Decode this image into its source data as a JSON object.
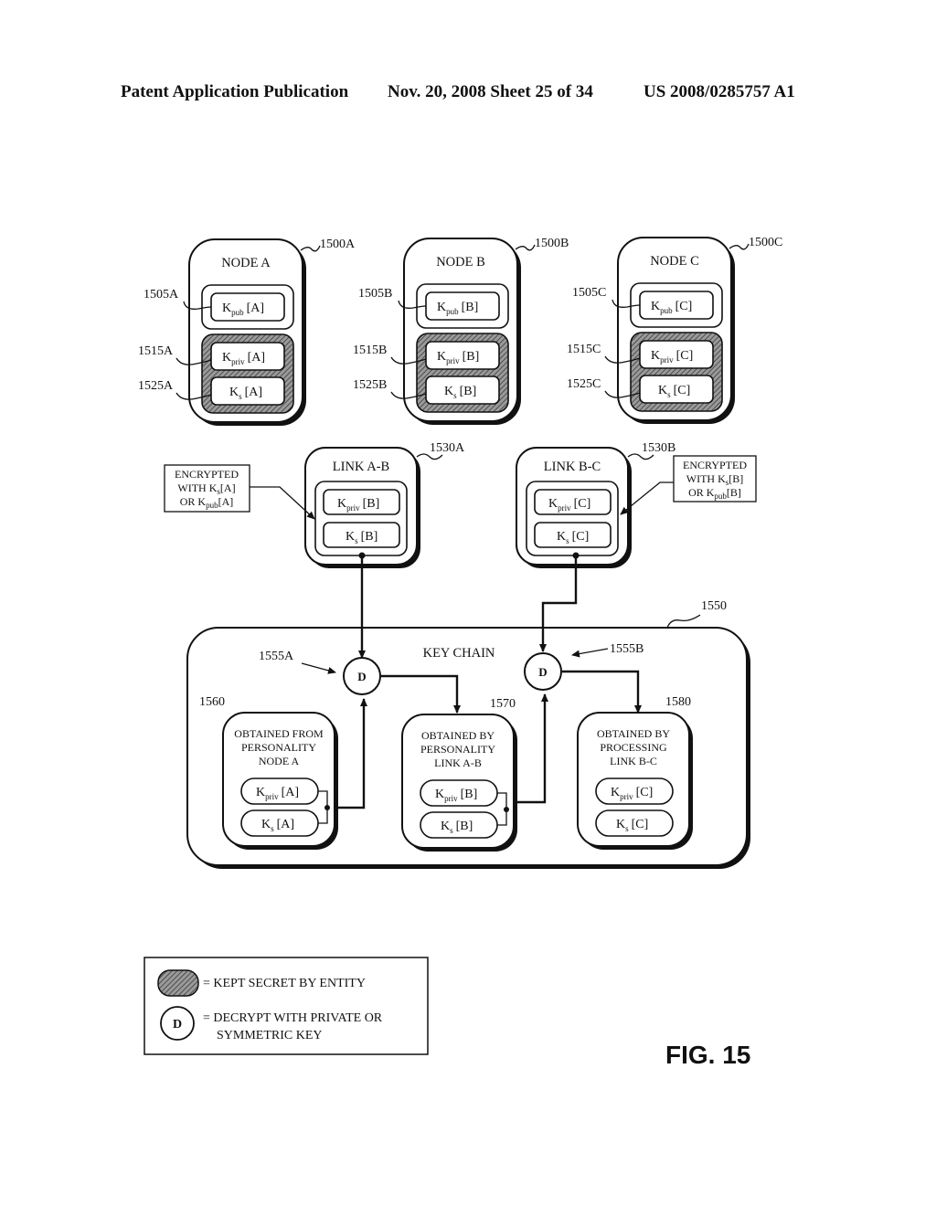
{
  "header": {
    "left": "Patent Application Publication",
    "date_sheet": "Nov. 20, 2008  Sheet 25 of 34",
    "number": "US 2008/0285757 A1"
  },
  "nodes": [
    {
      "ref": "1500A",
      "title": "NODE A",
      "pub_ref": "1505A",
      "priv_ref": "1515A",
      "ks_ref": "1525A",
      "id": "A"
    },
    {
      "ref": "1500B",
      "title": "NODE B",
      "pub_ref": "1505B",
      "priv_ref": "1515B",
      "ks_ref": "1525B",
      "id": "B"
    },
    {
      "ref": "1500C",
      "title": "NODE C",
      "pub_ref": "1505C",
      "priv_ref": "1515C",
      "ks_ref": "1525C",
      "id": "C"
    }
  ],
  "keys": {
    "pub": "K",
    "pub_sub": "pub",
    "priv": "K",
    "priv_sub": "priv",
    "s": "K",
    "s_sub": "s",
    "A": "[A]",
    "B": "[B]",
    "C": "[C]"
  },
  "links": [
    {
      "ref": "1530A",
      "title": "LINK A-B",
      "key_id": "[B]",
      "note": [
        "ENCRYPTED",
        "WITH K",
        "s",
        "[A]",
        "OR K",
        "pub",
        "[A]"
      ]
    },
    {
      "ref": "1530B",
      "title": "LINK B-C",
      "key_id": "[C]",
      "note": [
        "ENCRYPTED",
        "WITH K",
        "s",
        "[B]",
        "OR K",
        "pub",
        "[B]"
      ]
    }
  ],
  "keychain": {
    "ref": "1550",
    "title": "KEY CHAIN",
    "decrypt_a_ref": "1555A",
    "decrypt_b_ref": "1555B",
    "decrypt_label": "D",
    "boxes": [
      {
        "ref": "1560",
        "lines": [
          "OBTAINED FROM",
          "PERSONALITY",
          "NODE A"
        ],
        "key_id": "[A]"
      },
      {
        "ref": "1570",
        "lines": [
          "OBTAINED BY",
          "PERSONALITY",
          "LINK A-B"
        ],
        "key_id": "[B]"
      },
      {
        "ref": "1580",
        "lines": [
          "OBTAINED BY",
          "PROCESSING",
          "LINK B-C"
        ],
        "key_id": "[C]"
      }
    ]
  },
  "legend": {
    "secret": "= KEPT SECRET BY ENTITY",
    "decrypt_symbol": "D",
    "decrypt_line1": "= DECRYPT WITH PRIVATE OR",
    "decrypt_line2": "SYMMETRIC KEY"
  },
  "figure_label": "FIG. 15"
}
